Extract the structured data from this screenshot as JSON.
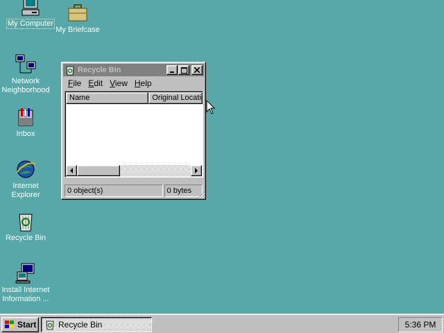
{
  "desktop": {
    "icons": [
      {
        "label": "My Computer"
      },
      {
        "label": "My Briefcase"
      },
      {
        "label_line1": "Network",
        "label_line2": "Neighborhood"
      },
      {
        "label": "Inbox"
      },
      {
        "label_line1": "Internet",
        "label_line2": "Explorer"
      },
      {
        "label": "Recycle Bin"
      },
      {
        "label_line1": "Install Internet",
        "label_line2": "Information ..."
      }
    ],
    "background_color": "#57a8a8"
  },
  "window": {
    "title": "Recycle Bin",
    "menu": [
      {
        "underline": "F",
        "rest": "ile"
      },
      {
        "underline": "E",
        "rest": "dit"
      },
      {
        "underline": "V",
        "rest": "iew"
      },
      {
        "underline": "H",
        "rest": "elp"
      }
    ],
    "columns": [
      "Name",
      "Original Locatio"
    ],
    "status": {
      "objects": "0 object(s)",
      "size": "0 bytes"
    }
  },
  "taskbar": {
    "start_label": "Start",
    "task_label": "Recycle Bin",
    "clock": "5:36 PM"
  }
}
